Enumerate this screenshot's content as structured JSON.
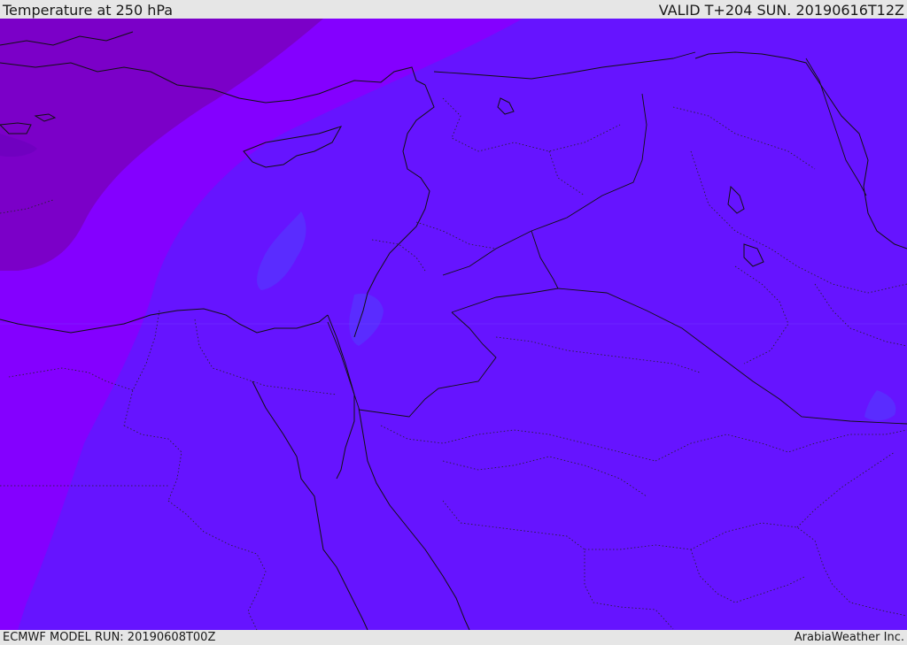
{
  "header": {
    "title": "Temperature at 250 hPa",
    "valid": "VALID T+204 SUN. 20190616T12Z"
  },
  "footer": {
    "model_run": "ECMWF MODEL RUN: 20190608T00Z",
    "credit": "ArabiaWeather Inc."
  },
  "map": {
    "field": "temperature",
    "level": "250 hPa",
    "colors": {
      "coldest": "#7b00c8",
      "cold": "#8400ff",
      "cool": "#6614ff",
      "cool_patch": "#5a2cff",
      "coastline": "#111111",
      "border": "#111111"
    }
  }
}
